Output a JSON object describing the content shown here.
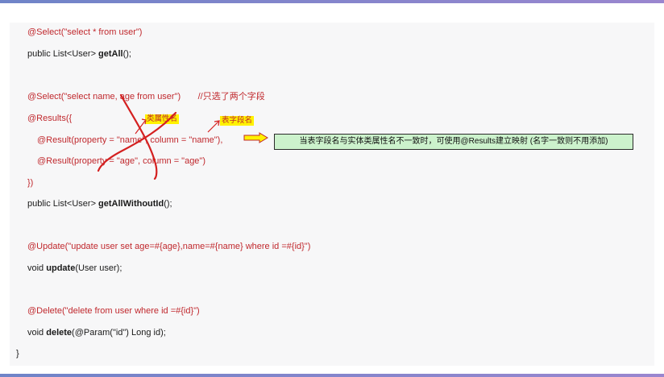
{
  "code": {
    "select_anno": "@Select(\"select * from user\")",
    "getall_prefix": "public List<User> ",
    "getall_name": "getAll",
    "getall_suffix": "();",
    "select2_anno": "@Select(\"select name, age from user\")",
    "select2_comment": "//只选了两个字段",
    "results_open": "@Results({",
    "result1": "@Result(property = \"name\", column = \"name\"),",
    "result2": "@Result(property = \"age\", column = \"age\")",
    "results_close": "})",
    "getallwithoutid_prefix": "public List<User> ",
    "getallwithoutid_name": "getAllWithoutId",
    "getallwithoutid_suffix": "();",
    "update_anno": "@Update(\"update user set age=#{age},name=#{name} where id =#{id}\")",
    "update_prefix": "void ",
    "update_name": "update",
    "update_suffix": "(User user);",
    "delete_anno": "@Delete(\"delete from user where id =#{id}\")",
    "delete_prefix": "void ",
    "delete_name": "delete",
    "delete_suffix": "(@Param(\"id\") Long id);",
    "closing_brace": "}"
  },
  "annotations": {
    "class_property_tag": "类属性名",
    "table_field_tag": "表字段名",
    "note": "当表字段名与实体类属性名不一致时，可使用@Results建立映射 (名字一致则不用添加)"
  },
  "colors": {
    "annotation_red": "#c0282d",
    "tag_yellow": "#fff200",
    "note_green": "#ccf2cc",
    "bar_blue": "#6f84c8"
  }
}
